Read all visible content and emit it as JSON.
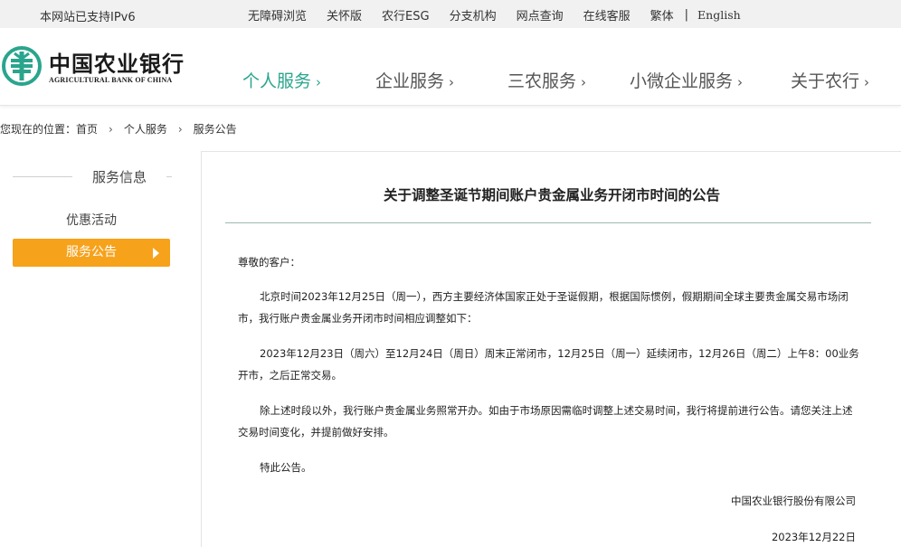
{
  "topbar": {
    "ipv6": "本网站已支持IPv6",
    "links": [
      "无障碍浏览",
      "关怀版",
      "农行ESG",
      "分支机构",
      "网点查询",
      "在线客服",
      "繁体"
    ],
    "separator": "|",
    "english": "English"
  },
  "logo": {
    "cn": "中国农业银行",
    "en": "AGRICULTURAL BANK OF CHINA"
  },
  "nav": {
    "items": [
      "个人服务",
      "企业服务",
      "三农服务",
      "小微企业服务",
      "关于农行"
    ],
    "chevron": "›"
  },
  "breadcrumb": {
    "prefix": "您现在的位置：",
    "items": [
      "首页",
      "个人服务",
      "服务公告"
    ],
    "separator": "›"
  },
  "sidebar": {
    "title": "服务信息",
    "items": [
      "优惠活动",
      "服务公告"
    ]
  },
  "article": {
    "title": "关于调整圣诞节期间账户贵金属业务开闭市时间的公告",
    "salutation": "尊敬的客户：",
    "paragraphs": [
      "北京时间2023年12月25日（周一），西方主要经济体国家正处于圣诞假期，根据国际惯例，假期期间全球主要贵金属交易市场闭市，我行账户贵金属业务开闭市时间相应调整如下：",
      "2023年12月23日（周六）至12月24日（周日）周末正常闭市，12月25日（周一）延续闭市，12月26日（周二）上午8：00业务开市，之后正常交易。",
      "除上述时段以外，我行账户贵金属业务照常开办。如由于市场原因需临时调整上述交易时间，我行将提前进行公告。请您关注上述交易时间变化，并提前做好安排。",
      "特此公告。"
    ],
    "signature": "中国农业银行股份有限公司",
    "date": "2023年12月22日"
  },
  "colors": {
    "brand_green": "#2aa58d",
    "active_orange": "#f7a21b",
    "topbar_bg": "#f1f1f1"
  }
}
